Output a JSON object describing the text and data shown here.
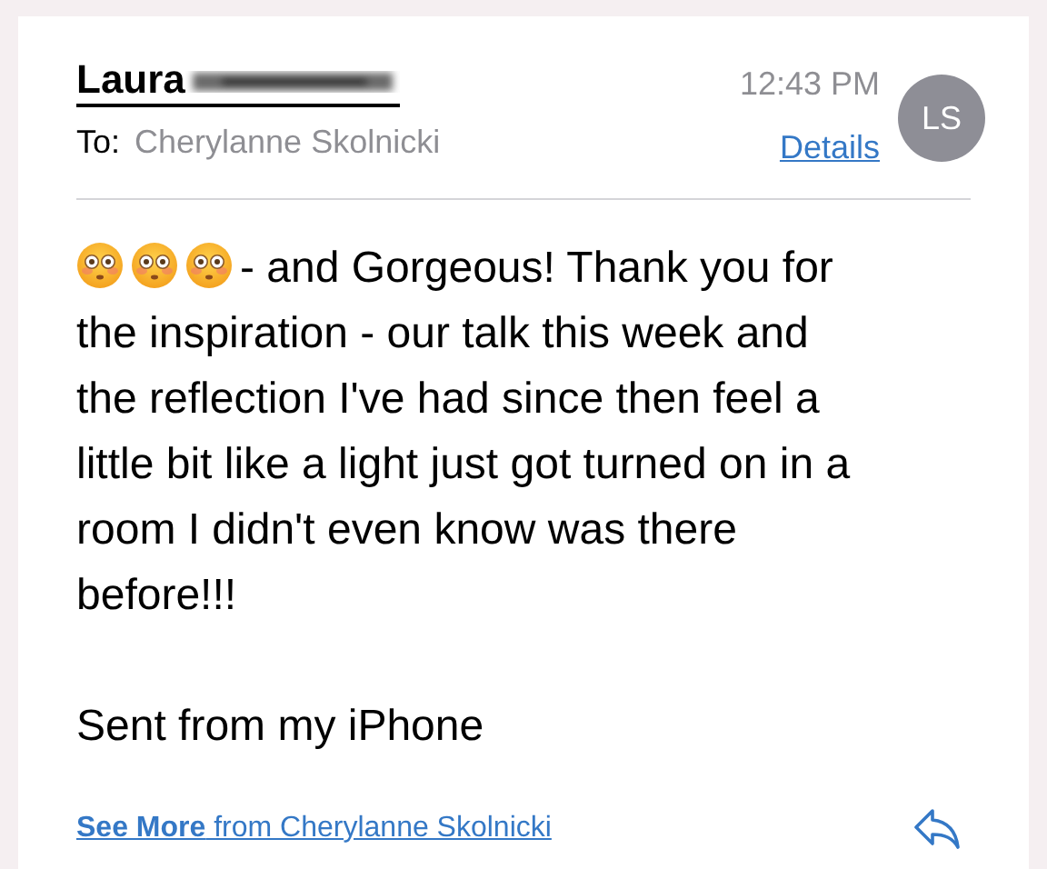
{
  "header": {
    "sender": "Laura",
    "sender_redacted": true,
    "to_label": "To:",
    "recipient": "Cherylanne Skolnicki",
    "time": "12:43 PM",
    "details_link": "Details",
    "avatar_initials": "LS"
  },
  "body": {
    "leading_icons": [
      {
        "kind": "flushed-face"
      },
      {
        "kind": "flushed-face"
      },
      {
        "kind": "flushed-face"
      }
    ],
    "paragraphs": [
      [
        "- and Gorgeous! Thank you for",
        "the inspiration - our talk this week and",
        "the reflection I've had since then feel a",
        "little bit like a light just got turned on in a",
        "room I didn't even know was there",
        "before!!!"
      ],
      [
        "Sent from my iPhone"
      ]
    ]
  },
  "footer": {
    "link": "**See More** from Cherylanne Skolnicki"
  }
}
